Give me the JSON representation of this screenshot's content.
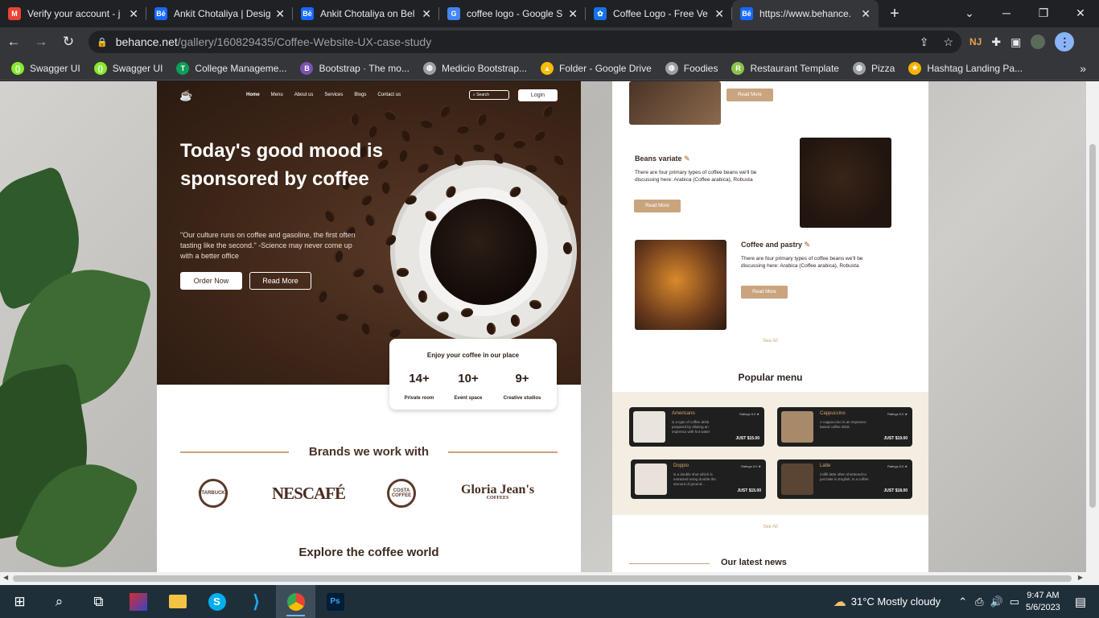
{
  "tabs": [
    {
      "title": "Verify your account - j",
      "icon": "gmail-icon",
      "color": "#ea4335",
      "glyph": "M",
      "active": false
    },
    {
      "title": "Ankit Chotaliya | Desig",
      "icon": "behance-icon",
      "color": "#1769ff",
      "glyph": "Bē",
      "active": false
    },
    {
      "title": "Ankit Chotaliya on Bel",
      "icon": "behance-icon",
      "color": "#1769ff",
      "glyph": "Bē",
      "active": false
    },
    {
      "title": "coffee logo - Google S",
      "icon": "google-icon",
      "color": "#4285f4",
      "glyph": "G",
      "active": false
    },
    {
      "title": "Coffee Logo - Free Ve",
      "icon": "freepik-icon",
      "color": "#1273eb",
      "glyph": "✿",
      "active": false
    },
    {
      "title": "https://www.behance.",
      "icon": "behance-icon",
      "color": "#1769ff",
      "glyph": "Bē",
      "active": true
    }
  ],
  "address": {
    "host": "behance.net",
    "path": "/gallery/160829435/Coffee-Website-UX-case-study"
  },
  "bookmarks": [
    {
      "label": "Swagger UI",
      "color": "#85ea2d",
      "glyph": "{}"
    },
    {
      "label": "Swagger UI",
      "color": "#85ea2d",
      "glyph": "{}"
    },
    {
      "label": "College Manageme...",
      "color": "#0f9d58",
      "glyph": "T"
    },
    {
      "label": "Bootstrap · The mo...",
      "color": "#7952b3",
      "glyph": "B"
    },
    {
      "label": "Medicio Bootstrap...",
      "color": "#9aa0a6",
      "glyph": "◍"
    },
    {
      "label": "Folder - Google Drive",
      "color": "#fbbc04",
      "glyph": "▲"
    },
    {
      "label": "Foodies",
      "color": "#9aa0a6",
      "glyph": "◍"
    },
    {
      "label": "Restaurant Template",
      "color": "#8bc34a",
      "glyph": "R"
    },
    {
      "label": "Pizza",
      "color": "#9aa0a6",
      "glyph": "◍"
    },
    {
      "label": "Hashtag Landing Pa...",
      "color": "#f5b400",
      "glyph": "★"
    }
  ],
  "hero": {
    "nav": [
      "Home",
      "Menu",
      "About us",
      "Services",
      "Blogs",
      "Contact us"
    ],
    "search": "Search",
    "login": "Login",
    "heading": "Today's good mood is sponsored by coffee",
    "sub": "\"Our culture runs on coffee and gasoline, the first often tasting like the second.\" -Science may never come up with a better office",
    "order": "Order Now",
    "read": "Read More"
  },
  "stats": {
    "title": "Enjoy your coffee in our place",
    "items": [
      {
        "n": "14+",
        "l": "Private room"
      },
      {
        "n": "10+",
        "l": "Event space"
      },
      {
        "n": "9+",
        "l": "Creative studios"
      }
    ]
  },
  "brands": {
    "title": "Brands we work with",
    "nescafe": "NESCAFÉ",
    "costa": "COSTA COFFEE",
    "gloria": "Gloria Jean's",
    "gloria_sub": "COFFEES",
    "starbucks": "STARBUCKS"
  },
  "explore": "Explore the coffee world",
  "features": [
    {
      "title": "Beans variate",
      "desc": "There are four primary types of coffee beans we'll be discussing here: Arabica (Coffee arabica), Robusta",
      "btn": "Read More"
    },
    {
      "title": "Coffee and pastry",
      "desc": "There are four primary types of coffee beans we'll be discussing here: Arabica (Coffee arabica), Robusta",
      "btn": "Read More"
    }
  ],
  "top_read_more": "Read More",
  "see_all": "See All",
  "popular": {
    "title": "Popular menu",
    "cards": [
      {
        "name": "Americano",
        "rating": "Ratings 5.0 ★",
        "desc": "is a type of coffee drink prepared by diluting an espresso with hot water",
        "price": "JUST $15.00"
      },
      {
        "name": "Cappuccino",
        "rating": "Ratings 5.0 ★",
        "desc": "A cappuccino is an espresso-based coffee drink",
        "price": "JUST $19.00"
      },
      {
        "name": "Doppio",
        "rating": "Ratings 5.0 ★",
        "desc": "is a double shot which is extracted using double the amount of ground...",
        "price": "JUST $15.00"
      },
      {
        "name": "Latte",
        "rating": "Ratings 5.0 ★",
        "desc": "Caffè latte often shortened to just latte in English, is a coffee",
        "price": "JUST $18.00"
      }
    ]
  },
  "news": "Our latest news",
  "taskbar": {
    "weather": "31°C  Mostly cloudy",
    "time": "9:47 AM",
    "date": "5/6/2023"
  }
}
